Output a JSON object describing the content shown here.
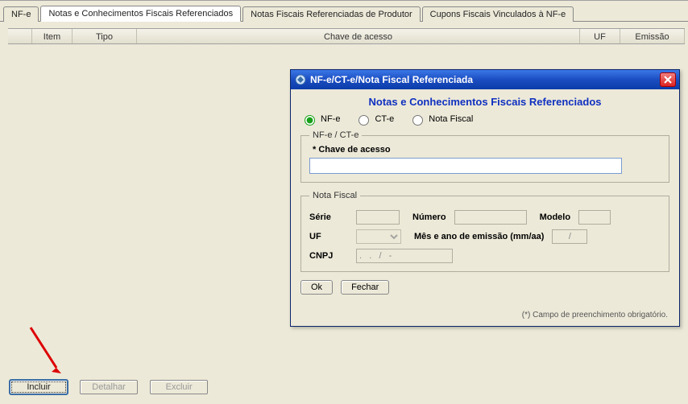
{
  "tabs": {
    "nfe": "NF-e",
    "notas_ref": "Notas e Conhecimentos Fiscais Referenciados",
    "produtor": "Notas Fiscais Referenciadas de Produtor",
    "cupons": "Cupons Fiscais Vinculados à NF-e"
  },
  "grid": {
    "columns": {
      "item": "Item",
      "tipo": "Tipo",
      "chave": "Chave de acesso",
      "uf": "UF",
      "emissao": "Emissão"
    }
  },
  "buttons": {
    "incluir": "Incluir",
    "detalhar": "Detalhar",
    "excluir": "Excluir"
  },
  "dialog": {
    "title": "NF-e/CT-e/Nota Fiscal Referenciada",
    "heading": "Notas e Conhecimentos Fiscais Referenciados",
    "radios": {
      "nfe": "NF-e",
      "cte": "CT-e",
      "nota_fiscal": "Nota Fiscal"
    },
    "group_nfe_cte": {
      "legend": "NF-e / CT-e",
      "chave_label": "* Chave de acesso",
      "chave_value": ""
    },
    "group_nota_fiscal": {
      "legend": "Nota Fiscal",
      "serie_label": "Série",
      "serie_value": "",
      "numero_label": "Número",
      "numero_value": "",
      "modelo_label": "Modelo",
      "modelo_value": "",
      "uf_label": "UF",
      "uf_value": "",
      "mes_ano_label": "Mês e ano de emissão (mm/aa)",
      "mes_ano_value": "/",
      "cnpj_label": "CNPJ",
      "cnpj_value": ".   .   /   -"
    },
    "ok": "Ok",
    "fechar": "Fechar",
    "footnote": "(*) Campo de preenchimento obrigatório."
  }
}
